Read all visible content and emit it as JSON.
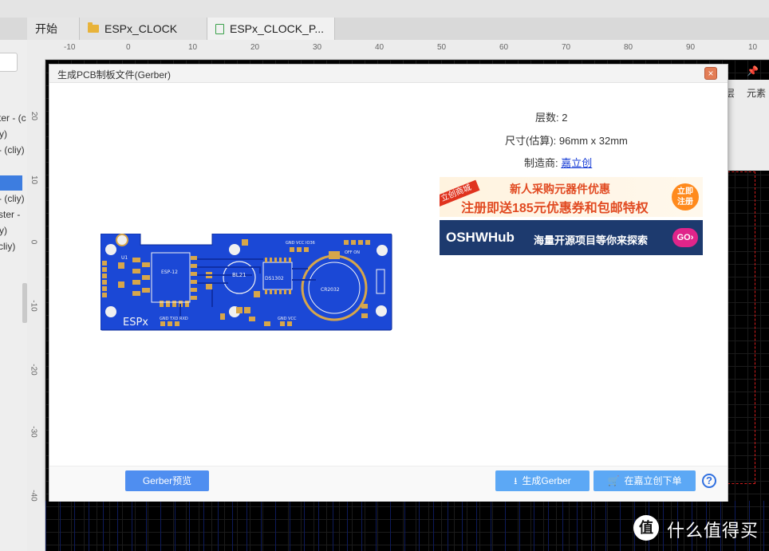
{
  "tabs": [
    {
      "label": "开始"
    },
    {
      "label": "ESPx_CLOCK"
    },
    {
      "label": "ESPx_CLOCK_P..."
    }
  ],
  "left_panel": {
    "items": [
      "ter - (c",
      "y)",
      "- (cliy)",
      "- (cliy)",
      "ster -",
      "y)",
      "cliy)"
    ]
  },
  "ruler": {
    "h_ticks": [
      "-10",
      "0",
      "10",
      "20",
      "30",
      "40",
      "50",
      "60",
      "70",
      "80",
      "90",
      "10"
    ],
    "v_ticks": [
      "20",
      "10",
      "0",
      "-10",
      "-20",
      "-30",
      "-40"
    ]
  },
  "right_panel": {
    "tabs": [
      "层",
      "元素"
    ]
  },
  "dialog": {
    "title": "生成PCB制板文件(Gerber)",
    "close_label": "×",
    "layers_label": "层数:",
    "layers_value": "2",
    "size_label": "尺寸(估算):",
    "size_value": "96mm x 32mm",
    "manufacturer_label": "制造商:",
    "manufacturer_value": "嘉立创",
    "ad1": {
      "ribbon": "立创商城",
      "line1": "新人采购元器件优惠",
      "line2": "注册即送185元优惠券和包邮特权",
      "badge": "立即注册"
    },
    "ad2": {
      "logo": "OSHWHub",
      "text": "海量开源项目等你来探索",
      "go": "GO›"
    },
    "preview_button": "Gerber预览",
    "generate_button": "生成Gerber",
    "order_button": "在嘉立创下单",
    "help_label": "?"
  },
  "pcb": {
    "silk_brand": "ESPx",
    "silk_bl21": "BL21",
    "silk_ds1302": "DS1302",
    "silk_battery": "CR2032",
    "silk_gnd_txd": "GND TXD RXD",
    "silk_gnd_vcc": "GND VCC",
    "silk_gnd_vcc_io": "GND VCC IO36",
    "silk_off_on": "OFF ON",
    "silk_esp": "ESP-12",
    "silk_u1": "U1"
  },
  "watermark": {
    "icon": "值",
    "text": "什么值得买"
  }
}
